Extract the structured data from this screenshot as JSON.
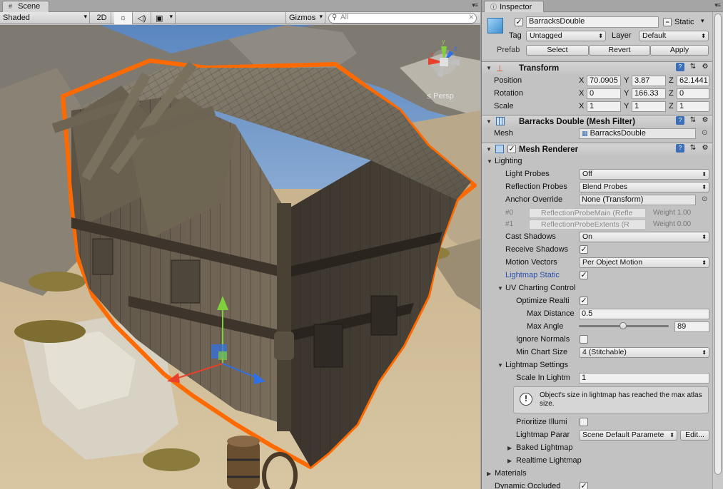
{
  "scene": {
    "tab_label": "Scene",
    "shading_mode": "Shaded",
    "mode_2d": "2D",
    "gizmos_label": "Gizmos",
    "search_placeholder": "All",
    "camera_mode": "Persp"
  },
  "inspector": {
    "tab_label": "Inspector",
    "object_name": "BarracksDouble",
    "active": true,
    "static_label": "Static",
    "static_checked": false,
    "tag_label": "Tag",
    "tag_value": "Untagged",
    "layer_label": "Layer",
    "layer_value": "Default",
    "prefab_label": "Prefab",
    "prefab_select": "Select",
    "prefab_revert": "Revert",
    "prefab_apply": "Apply"
  },
  "transform": {
    "title": "Transform",
    "position_label": "Position",
    "rotation_label": "Rotation",
    "scale_label": "Scale",
    "axis_x": "X",
    "axis_y": "Y",
    "axis_z": "Z",
    "position": {
      "x": "70.0905",
      "y": "3.87",
      "z": "62.1441"
    },
    "rotation": {
      "x": "0",
      "y": "166.33",
      "z": "0"
    },
    "scale": {
      "x": "1",
      "y": "1",
      "z": "1"
    }
  },
  "mesh_filter": {
    "title": "Barracks Double (Mesh Filter)",
    "mesh_label": "Mesh",
    "mesh_value": "BarracksDouble"
  },
  "mesh_renderer": {
    "title": "Mesh Renderer",
    "enabled": true,
    "lighting_label": "Lighting",
    "light_probes_label": "Light Probes",
    "light_probes_value": "Off",
    "reflection_probes_label": "Reflection Probes",
    "reflection_probes_value": "Blend Probes",
    "anchor_override_label": "Anchor Override",
    "anchor_override_value": "None (Transform)",
    "probe_rows": [
      {
        "index": "#0",
        "name": "ReflectionProbeMain (Refle",
        "weight": "Weight 1.00"
      },
      {
        "index": "#1",
        "name": "ReflectionProbeExtents (R",
        "weight": "Weight 0.00"
      }
    ],
    "cast_shadows_label": "Cast Shadows",
    "cast_shadows_value": "On",
    "receive_shadows_label": "Receive Shadows",
    "receive_shadows": true,
    "motion_vectors_label": "Motion Vectors",
    "motion_vectors_value": "Per Object Motion",
    "lightmap_static_label": "Lightmap Static",
    "lightmap_static": true,
    "uv_charting_label": "UV Charting Control",
    "optimize_label": "Optimize Realti",
    "optimize": true,
    "max_distance_label": "Max Distance",
    "max_distance_value": "0.5",
    "max_angle_label": "Max Angle",
    "max_angle_value": "89",
    "max_angle_fraction": 0.49,
    "ignore_normals_label": "Ignore Normals",
    "ignore_normals": false,
    "min_chart_size_label": "Min Chart Size",
    "min_chart_size_value": "4 (Stitchable)",
    "lightmap_settings_label": "Lightmap Settings",
    "scale_in_lightmap_label": "Scale In Lightm",
    "scale_in_lightmap_value": "1",
    "help_text": "Object's size in lightmap has reached the max atlas size.",
    "prioritize_label": "Prioritize Illumi",
    "prioritize": false,
    "lightmap_params_label": "Lightmap Parar",
    "lightmap_params_value": "Scene Default Paramete",
    "edit_button": "Edit...",
    "baked_lightmap_label": "Baked Lightmap",
    "realtime_lightmap_label": "Realtime Lightmap",
    "materials_label": "Materials",
    "dynamic_occluded_label": "Dynamic Occluded",
    "dynamic_occluded": true
  },
  "colors": {
    "selection_outline": "#ff6a00",
    "gizmo_x": "#e8402a",
    "gizmo_y": "#7fd03a",
    "gizmo_z": "#2f6fe8",
    "link_blue": "#2b4fb0"
  }
}
